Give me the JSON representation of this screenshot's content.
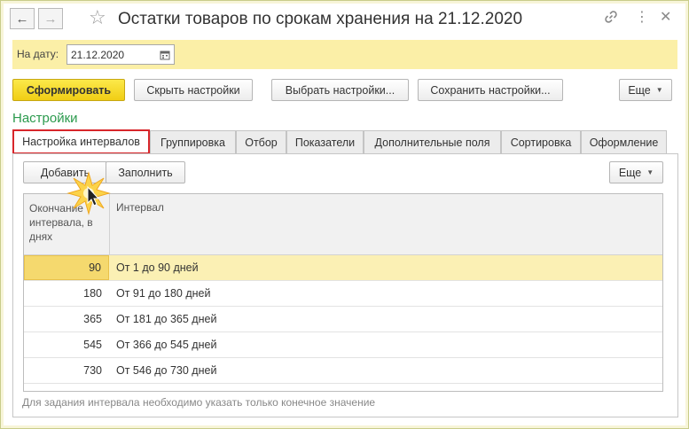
{
  "window": {
    "title": "Остатки товаров по срокам хранения на 21.12.2020",
    "icons": [
      "back-arrow-icon",
      "forward-arrow-icon",
      "star-icon",
      "link-icon",
      "more-vertical-icon",
      "close-icon"
    ],
    "glyphs": {
      "back": "←",
      "forward": "→",
      "star": "☆",
      "more": "⋮",
      "close": "✕"
    }
  },
  "datebar": {
    "label": "На дату:",
    "value": "21.12.2020"
  },
  "toolbar": {
    "generate": "Сформировать",
    "hide_settings": "Скрыть настройки",
    "choose_settings": "Выбрать настройки...",
    "save_settings": "Сохранить настройки...",
    "more": "Еще"
  },
  "settings": {
    "title": "Настройки",
    "tabs": [
      {
        "label": "Настройка интервалов",
        "active": true
      },
      {
        "label": "Группировка",
        "active": false
      },
      {
        "label": "Отбор",
        "active": false
      },
      {
        "label": "Показатели",
        "active": false
      },
      {
        "label": "Дополнительные поля",
        "active": false
      },
      {
        "label": "Сортировка",
        "active": false
      },
      {
        "label": "Оформление",
        "active": false
      }
    ],
    "panel_toolbar": {
      "add": "Добавить",
      "fill": "Заполнить",
      "more": "Еще"
    },
    "table": {
      "columns": [
        "Окончание интервала, в днях",
        "Интервал"
      ],
      "rows": [
        {
          "end": "90",
          "interval": "От 1 до 90 дней",
          "selected": true
        },
        {
          "end": "180",
          "interval": "От 91 до 180 дней",
          "selected": false
        },
        {
          "end": "365",
          "interval": "От 181 до 365 дней",
          "selected": false
        },
        {
          "end": "545",
          "interval": "От 366 до 545 дней",
          "selected": false
        },
        {
          "end": "730",
          "interval": "От 546 до 730 дней",
          "selected": false
        }
      ]
    },
    "hint": "Для задания интервала необходимо указать только конечное значение"
  },
  "colors": {
    "accent_yellow": "#f0cd14",
    "date_bar": "#fbefa7",
    "section_title": "#2b9a4d",
    "active_tab_border": "#d8262b",
    "selected_row": "#fbf0b4"
  }
}
